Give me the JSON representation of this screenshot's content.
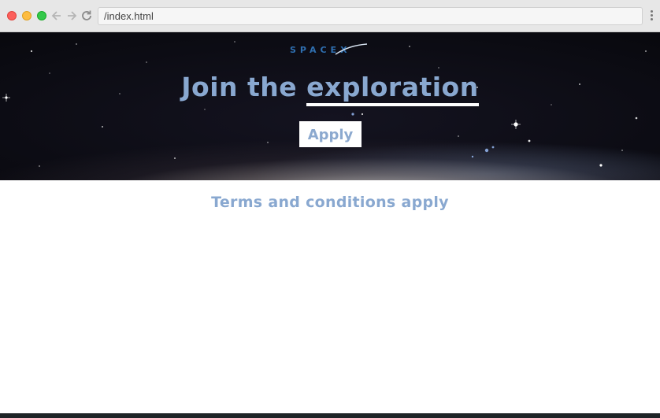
{
  "browser": {
    "url": "/index.html",
    "icons": [
      "back-arrow-icon",
      "forward-arrow-icon",
      "reload-icon",
      "menu-kebab-icon"
    ]
  },
  "hero": {
    "logo_text": "SPACEX",
    "headline_prefix": "Join the",
    "headline_accent": "exploration",
    "apply_label": "Apply"
  },
  "content": {
    "terms_text": "Terms and conditions apply"
  },
  "colors": {
    "accent_text": "#89a8d0",
    "underline": "#ffffff",
    "footer": "#1e2426"
  }
}
